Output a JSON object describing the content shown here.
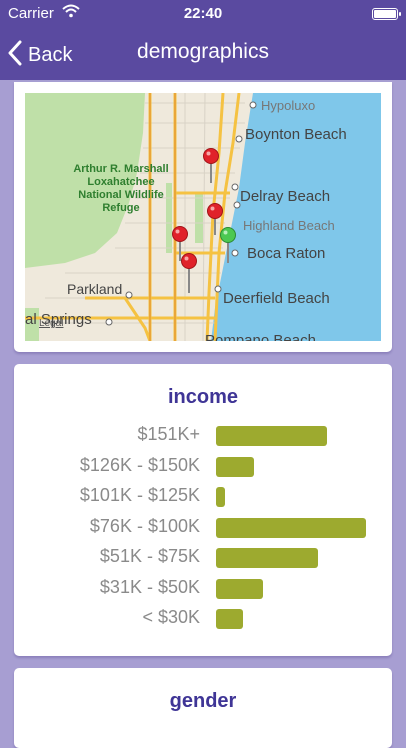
{
  "status": {
    "carrier": "Carrier",
    "time": "22:40"
  },
  "nav": {
    "back_label": "Back",
    "title": "demographics"
  },
  "map": {
    "refuge_line1": "Arthur R. Marshall",
    "refuge_line2": "Loxahatchee",
    "refuge_line3": "National Wildlife",
    "refuge_line4": "Refuge",
    "places": [
      "Hypoluxo",
      "Boynton Beach",
      "Delray Beach",
      "Highland Beach",
      "Boca Raton",
      "Deerfield Beach",
      "Parkland",
      "al Springs",
      "Pompano Beach"
    ],
    "legal": "Legal"
  },
  "income": {
    "title": "income",
    "chart_data": {
      "type": "bar",
      "orientation": "horizontal",
      "categories": [
        "$151K+",
        "$126K - $150K",
        "$101K - $125K",
        "$76K - $100K",
        "$51K - $75K",
        "$31K - $50K",
        "< $30K"
      ],
      "values": [
        0.74,
        0.25,
        0.06,
        1.0,
        0.68,
        0.31,
        0.18
      ],
      "bar_color": "#9daa2f"
    }
  },
  "gender": {
    "title": "gender"
  },
  "colors": {
    "nav": "#5a4aa0",
    "background": "#a79ed2",
    "title": "#3f3596",
    "bar": "#9daa2f"
  }
}
